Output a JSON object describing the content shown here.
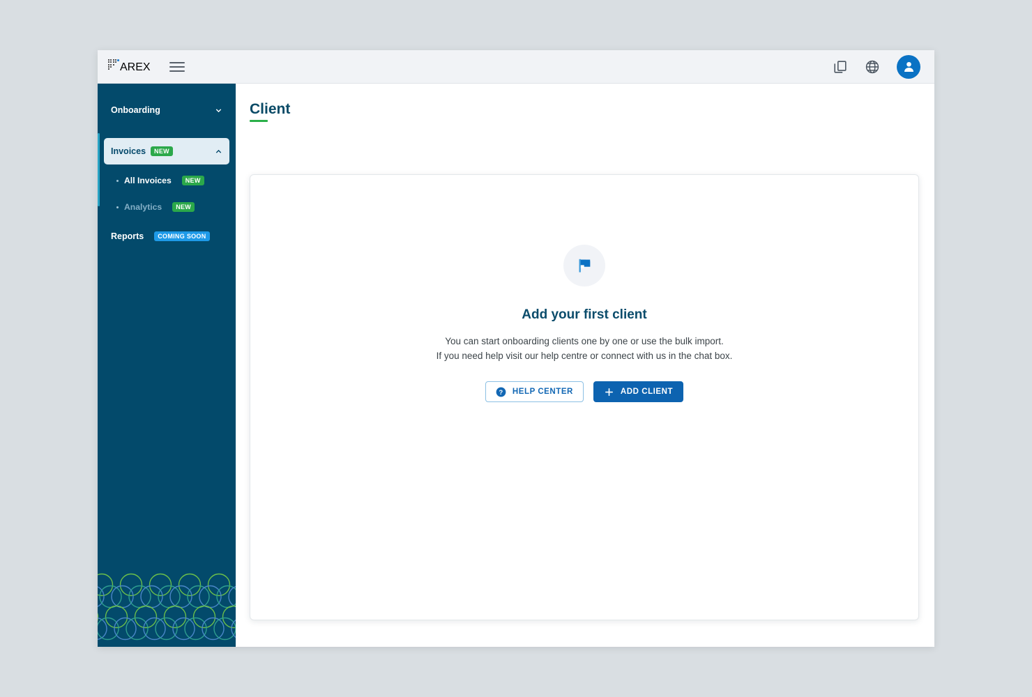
{
  "brand": {
    "name": "AREX",
    "logo_icon": "dot-matrix-logo",
    "accent_dot_color": "#1e7fd4"
  },
  "topbar": {
    "menu_icon": "hamburger-menu-icon",
    "actions": [
      {
        "icon": "copy-icon",
        "name": "copy-button"
      },
      {
        "icon": "globe-icon",
        "name": "language-button"
      },
      {
        "icon": "user-avatar-icon",
        "name": "account-avatar"
      }
    ]
  },
  "sidebar": {
    "background_color": "#034a6b",
    "active_item_background": "#e1edf4",
    "active_accent_color": "#2aa3c4",
    "items": [
      {
        "label": "Onboarding",
        "chevron": "chevron-down-icon",
        "expanded": false,
        "badge": null
      },
      {
        "label": "Invoices",
        "chevron": "chevron-up-icon",
        "expanded": true,
        "badge": "NEW",
        "badge_type": "new"
      }
    ],
    "sub_items": [
      {
        "label": "All Invoices",
        "badge": "NEW",
        "badge_type": "new",
        "active": true
      },
      {
        "label": "Analytics",
        "badge": "NEW",
        "badge_type": "new",
        "active": false
      }
    ],
    "reports": {
      "label": "Reports",
      "badge": "COMING SOON",
      "badge_type": "soon"
    },
    "decoration": {
      "name": "circles-pattern",
      "colors": [
        "#6cbf4a",
        "#4a86c8",
        "#2f9e8f"
      ]
    }
  },
  "main": {
    "page_title": "Client",
    "title_underline_color": "#2bb04a",
    "empty_state": {
      "icon": "flag-icon",
      "icon_color": "#0b72c4",
      "heading": "Add your first client",
      "body_line_1": "You can start onboarding clients one by one or use the bulk import.",
      "body_line_2": "If you need help visit our help centre or connect with us in the chat box.",
      "buttons": [
        {
          "label": "HELP CENTER",
          "icon": "question-circle-icon",
          "style": "outline"
        },
        {
          "label": "ADD CLIENT",
          "icon": "plus-icon",
          "style": "primary"
        }
      ]
    }
  }
}
